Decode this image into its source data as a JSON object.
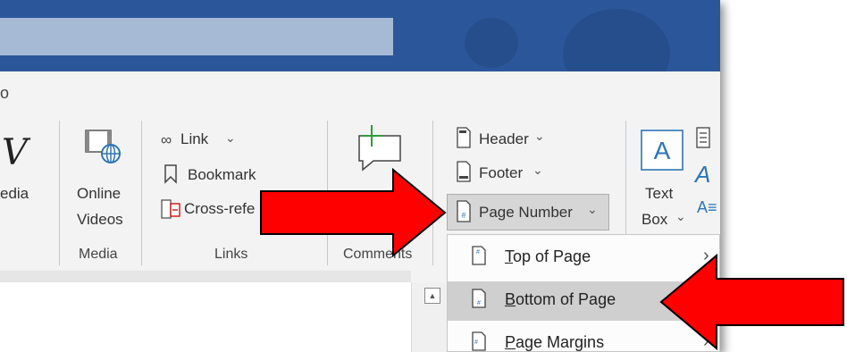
{
  "ribbon": {
    "tab_fragment": "o",
    "media_group": {
      "partial_label": "edia",
      "online_videos_line1": "Online",
      "online_videos_line2": "Videos",
      "group_label": "Media"
    },
    "links_group": {
      "link_label": "Link",
      "bookmark_label": "Bookmark",
      "crossref_label": "Cross-refe",
      "group_label": "Links"
    },
    "comments_group": {
      "group_label": "Comments"
    },
    "header_footer_group": {
      "header_label": "Header",
      "footer_label": "Footer",
      "page_number_label": "Page Number"
    },
    "text_group": {
      "text_box_line1": "Text",
      "text_box_line2": "Box"
    }
  },
  "page_number_menu": {
    "items": [
      {
        "label": "Top of Page",
        "icon": "top-of-page-icon",
        "submenu": true,
        "selected": false
      },
      {
        "label": "Bottom of Page",
        "icon": "bottom-of-page-icon",
        "submenu": true,
        "selected": true
      },
      {
        "label": "Page Margins",
        "icon": "page-margins-icon",
        "submenu": true,
        "selected": false
      }
    ]
  },
  "colors": {
    "titlebar": "#2b579a",
    "annotation_arrow": "#ff0000",
    "selected_item": "#cfcfcf"
  }
}
